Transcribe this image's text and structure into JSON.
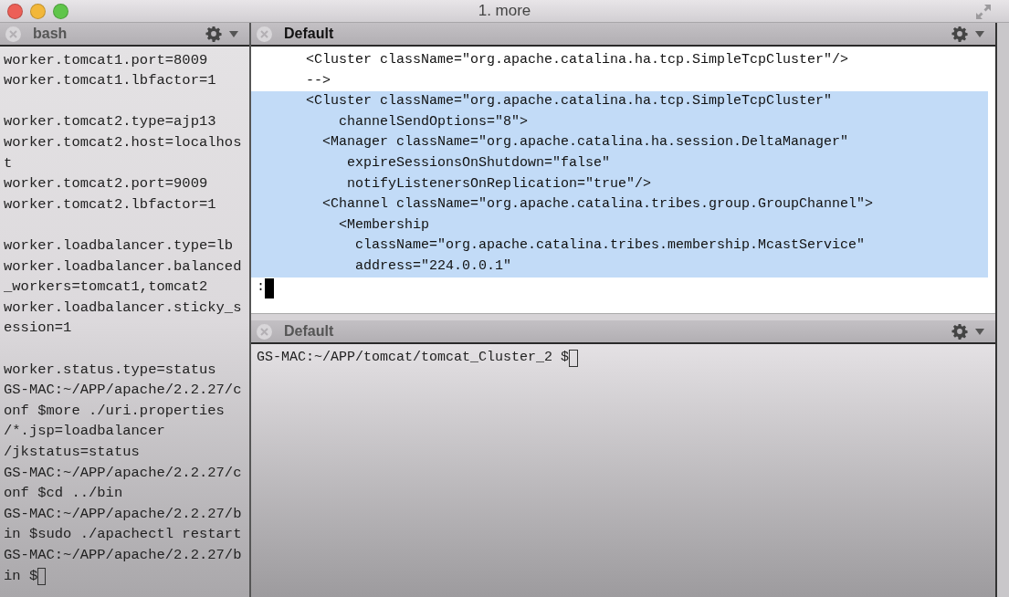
{
  "window": {
    "title": "1. more"
  },
  "left_pane": {
    "tab": {
      "title": "bash",
      "active": false
    },
    "blocks": [
      [
        {
          "kind": "text",
          "text": "worker.tomcat1.port=8009"
        },
        {
          "kind": "text",
          "text": "worker.tomcat1.lbfactor=1"
        }
      ],
      [
        {
          "kind": "text",
          "text": "worker.tomcat2.type=ajp13"
        },
        {
          "kind": "text",
          "text": "worker.tomcat2.host=localhos"
        },
        {
          "kind": "text",
          "text": "t"
        },
        {
          "kind": "text",
          "text": "worker.tomcat2.port=9009"
        },
        {
          "kind": "text",
          "text": "worker.tomcat2.lbfactor=1"
        }
      ],
      [
        {
          "kind": "text",
          "text": "worker.loadbalancer.type=lb"
        },
        {
          "kind": "text",
          "text": "worker.loadbalancer.balanced"
        },
        {
          "kind": "text",
          "text": "_workers=tomcat1,tomcat2"
        },
        {
          "kind": "text",
          "text": "worker.loadbalancer.sticky_s"
        },
        {
          "kind": "text",
          "text": "ession=1"
        }
      ],
      [
        {
          "kind": "text",
          "text": "worker.status.type=status"
        },
        {
          "kind": "text",
          "text": "GS-MAC:~/APP/apache/2.2.27/c"
        },
        {
          "kind": "text",
          "text": "onf $more ./uri.properties"
        },
        {
          "kind": "text",
          "text": "/*.jsp=loadbalancer"
        },
        {
          "kind": "text",
          "text": "/jkstatus=status"
        },
        {
          "kind": "text",
          "text": "GS-MAC:~/APP/apache/2.2.27/c"
        },
        {
          "kind": "text",
          "text": "onf $cd ../bin"
        },
        {
          "kind": "text",
          "text": "GS-MAC:~/APP/apache/2.2.27/b"
        },
        {
          "kind": "text",
          "text": "in $sudo ./apachectl restart"
        },
        {
          "kind": "text",
          "text": "GS-MAC:~/APP/apache/2.2.27/b"
        },
        {
          "kind": "prompt",
          "text": "in $"
        }
      ]
    ]
  },
  "top_pane": {
    "tab": {
      "title": "Default",
      "active": true
    },
    "lines": [
      {
        "text": "      <Cluster className=\"org.apache.catalina.ha.tcp.SimpleTcpCluster\"/>",
        "selected": false
      },
      {
        "text": "      -->",
        "selected": false
      },
      {
        "text": "      <Cluster className=\"org.apache.catalina.ha.tcp.SimpleTcpCluster\"",
        "selected": true
      },
      {
        "text": "          channelSendOptions=\"8\">",
        "selected": true
      },
      {
        "text": "        <Manager className=\"org.apache.catalina.ha.session.DeltaManager\"",
        "selected": true
      },
      {
        "text": "           expireSessionsOnShutdown=\"false\"",
        "selected": true
      },
      {
        "text": "           notifyListenersOnReplication=\"true\"/>",
        "selected": true
      },
      {
        "text": "        <Channel className=\"org.apache.catalina.tribes.group.GroupChannel\">",
        "selected": true
      },
      {
        "text": "          <Membership",
        "selected": true
      },
      {
        "text": "            className=\"org.apache.catalina.tribes.membership.McastService\"",
        "selected": true
      },
      {
        "text": "            address=\"224.0.0.1\"",
        "selected": true
      }
    ],
    "prompt": ":"
  },
  "bottom_pane": {
    "tab": {
      "title": "Default",
      "active": false
    },
    "lines": [
      {
        "kind": "prompt",
        "text": "GS-MAC:~/APP/tomcat/tomcat_Cluster_2 $"
      }
    ]
  }
}
